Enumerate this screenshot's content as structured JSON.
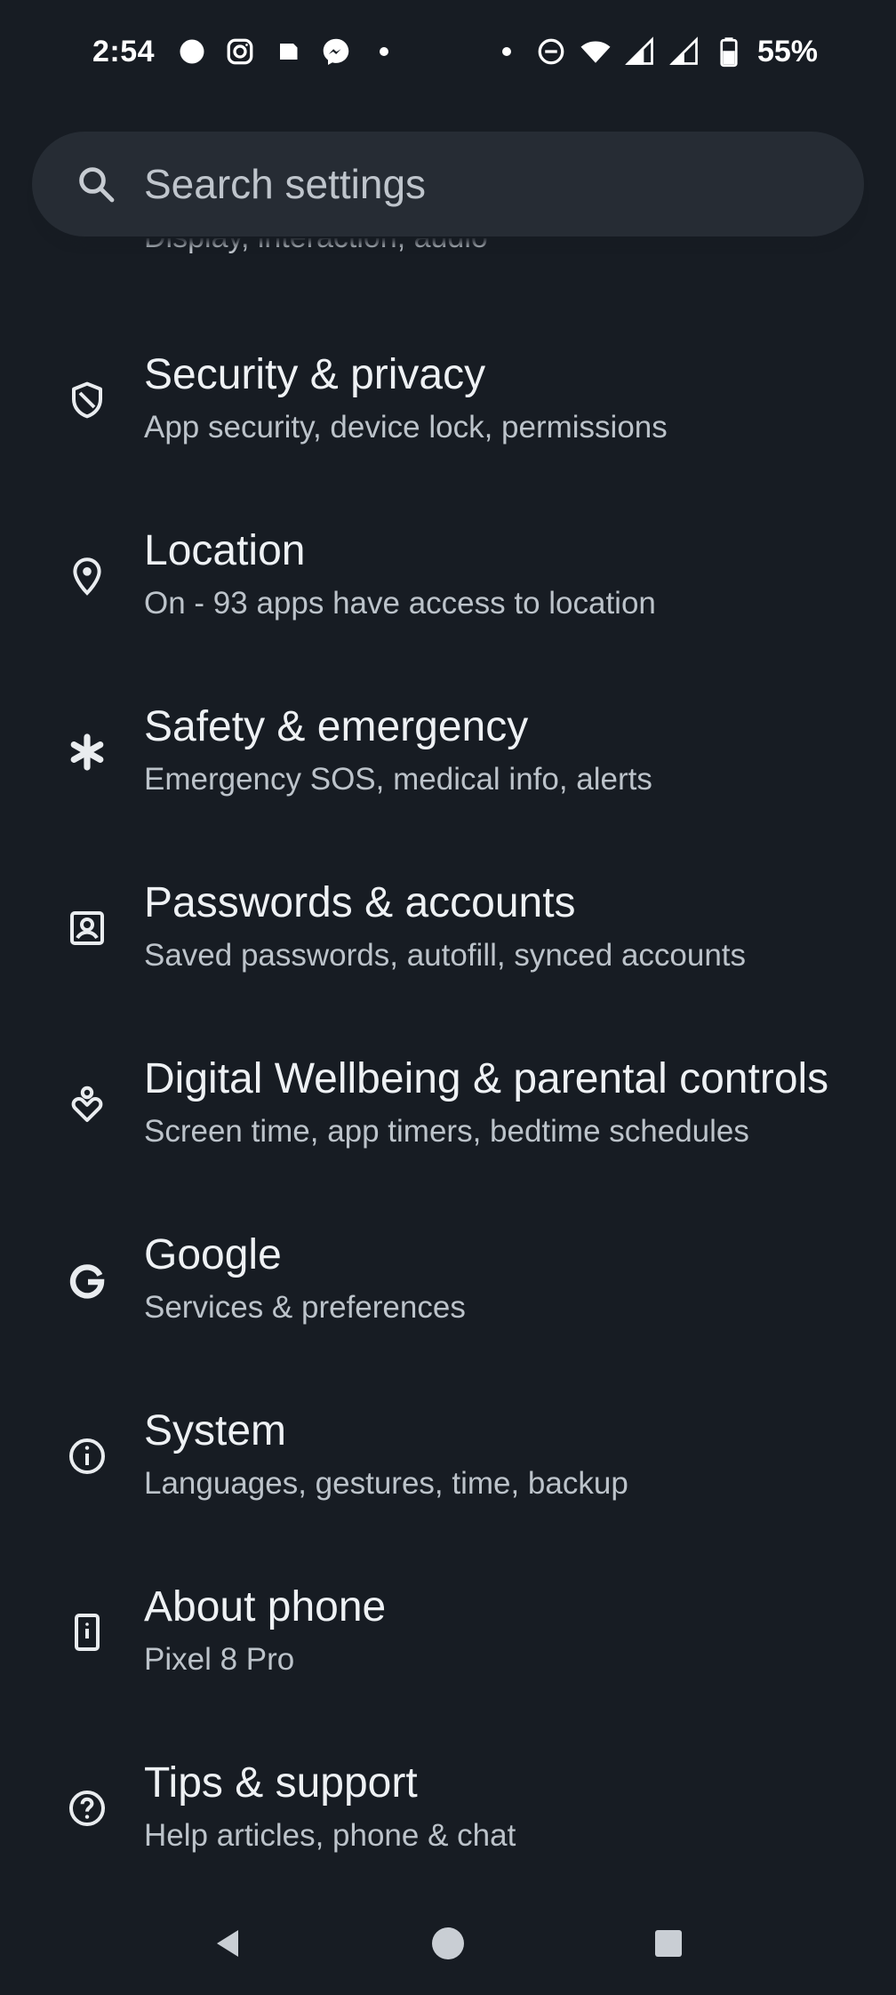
{
  "status_bar": {
    "time": "2:54",
    "battery_percent": "55%",
    "left_icons": [
      "circle-notification-icon",
      "instagram-icon",
      "app-notification-icon",
      "messenger-icon",
      "more-notifications-dot"
    ],
    "right_icons": [
      "dot-icon",
      "do-not-disturb-icon",
      "wifi-icon",
      "cell-signal-icon",
      "cell-signal-2-icon",
      "battery-icon"
    ]
  },
  "search": {
    "placeholder": "Search settings"
  },
  "previous_item": {
    "subtitle": "Display, interaction, audio"
  },
  "settings": {
    "items": [
      {
        "title": "Security & privacy",
        "subtitle": "App security, device lock, permissions",
        "icon": "shield-icon"
      },
      {
        "title": "Location",
        "subtitle": "On - 93 apps have access to location",
        "icon": "location-pin-icon"
      },
      {
        "title": "Safety & emergency",
        "subtitle": "Emergency SOS, medical info, alerts",
        "icon": "asterisk-icon"
      },
      {
        "title": "Passwords & accounts",
        "subtitle": "Saved passwords, autofill, synced accounts",
        "icon": "account-box-icon"
      },
      {
        "title": "Digital Wellbeing & parental controls",
        "subtitle": "Screen time, app timers, bedtime schedules",
        "icon": "wellbeing-icon"
      },
      {
        "title": "Google",
        "subtitle": "Services & preferences",
        "icon": "google-icon"
      },
      {
        "title": "System",
        "subtitle": "Languages, gestures, time, backup",
        "icon": "info-icon"
      },
      {
        "title": "About phone",
        "subtitle": "Pixel 8 Pro",
        "icon": "phone-icon"
      },
      {
        "title": "Tips & support",
        "subtitle": "Help articles, phone & chat",
        "icon": "help-icon"
      }
    ]
  },
  "colors": {
    "background": "#171c23",
    "search_background": "#262c34",
    "title_text": "#eef1f4",
    "subtitle_text": "#bcc3ca"
  }
}
